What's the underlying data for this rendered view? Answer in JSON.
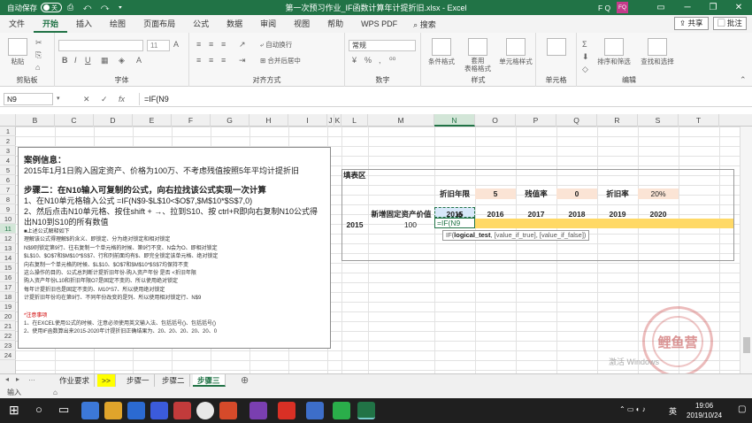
{
  "titlebar": {
    "autosave_label": "自动保存",
    "autosave_state": "关",
    "title": "第一次预习作业_IF函数计算年计提折旧.xlsx  -  Excel",
    "user_initials": "F Q",
    "avatar_text": "FQ"
  },
  "tabs": [
    "文件",
    "开始",
    "插入",
    "绘图",
    "页面布局",
    "公式",
    "数据",
    "审阅",
    "视图",
    "帮助",
    "WPS PDF"
  ],
  "active_tab": "开始",
  "search_label": "搜索",
  "share_label": "共享",
  "comment_label": "批注",
  "ribbon": {
    "paste_label": "粘贴",
    "clipboard_label": "剪贴板",
    "font_label": "字体",
    "font_size": "11",
    "align_label": "对齐方式",
    "wrap_label": "自动换行",
    "merge_label": "合并后居中",
    "number_label": "数字",
    "number_format": "常规",
    "style_label": "样式",
    "conditional_label": "条件格式",
    "table_label": "套用\n表格格式",
    "cellstyle_label": "单元格样式",
    "cells_label": "单元格",
    "edit_label": "编辑",
    "sort_label": "排序和筛选",
    "find_label": "查找和选择"
  },
  "formula": {
    "namebox": "N9",
    "cancel": "✕",
    "confirm": "✓",
    "fx": "fx",
    "content": "=IF(N9"
  },
  "columns": [
    "B",
    "C",
    "D",
    "E",
    "F",
    "G",
    "H",
    "I",
    "J",
    "K",
    "L",
    "M",
    "N",
    "O",
    "P",
    "Q",
    "R",
    "S",
    "T"
  ],
  "rows": [
    "1",
    "2",
    "3",
    "4",
    "5",
    "6",
    "7",
    "8",
    "9",
    "10",
    "11",
    "12",
    "13",
    "14",
    "15",
    "16",
    "17",
    "18",
    "19",
    "20",
    "21",
    "22",
    "23",
    "24"
  ],
  "info": {
    "case_title": "案例信息：",
    "case_text": "2015年1月1日购入固定资产、价格为100万、不考虑残值按照5年平均计提折旧",
    "step_title": "步骤二：在N10输入可复制的公式，向右拉找该公式实现一次计算",
    "step_1": "1、在N10单元格输入公式 =IF(N$9-$L$10<$O$7,$M$10*$S$7,0)",
    "step_2": "2、然后点击N10单元格、按住shift + →、拉到S10、按 ctrl+R即向右复制N10公式得出N10到S10的所有数值",
    "detail_header": "■上述公式解释如下",
    "detail_lines": [
      "理解该公式得理解$的含义、即锁定、分为绝对锁定和相对锁定",
      "N$9则锁定第9行、往右复制一个单元格的时候、第9行不变、N会为O、即相对锁定",
      "$L$10、$O$7和$M$10*$S$7、行和列前面均有$、即完全锁定该单元格、绝对锁定",
      "向右复制一个单元格的时候、$L$10、$O$7和$M$10*$S$7均保持不变",
      "这么操作的目的、公式总判断计提折旧年份-购入资产年份 是否 <折旧年限",
      "购入资产年份L10和折旧年限O7是固定不变的、所以使用绝对锁定",
      "每年计提折旧也是固定不变的、M10*S7、所以使用绝对锁定",
      "计提折旧年份均在第9行、不同年份改变的是列、所以使用相对锁定行、N$9"
    ],
    "note_header": "*注意事项",
    "note_lines": [
      "1、在EXCEL使用公式的时候、注意必须使用英文输入法、包括括号()、包括括号()",
      "2、使用IF函数算出来2015-2020年计提折旧正确结果为、20、20、20、20、20、0"
    ]
  },
  "fill": {
    "area_title": "填表区",
    "years_label": "折旧年限",
    "years_value": "5",
    "residual_label": "残值率",
    "residual_value": "0",
    "rate_label": "折旧率",
    "rate_value": "20%",
    "asset_label": "新增固定资产价值",
    "year_headers": [
      "2015",
      "2016",
      "2017",
      "2018",
      "2019",
      "2020"
    ],
    "row_year": "2015",
    "row_value": "100",
    "editing": "=IF(N9",
    "tooltip_func": "IF(",
    "tooltip_bold": "logical_test",
    "tooltip_rest": ", [value_if_true], [value_if_false])"
  },
  "sheets": [
    "作业要求",
    ">>",
    "步骤一",
    "步骤二",
    "步骤三"
  ],
  "active_sheet": "步骤三",
  "status_mode": "输入",
  "watermark": "激活 Windows",
  "seal_text": "鲤鱼营",
  "clock": {
    "time": "19:06",
    "date": "2019/10/24"
  },
  "ime": "英"
}
